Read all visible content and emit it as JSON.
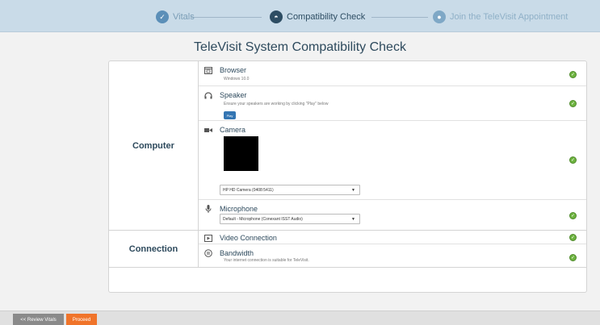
{
  "stepper": {
    "steps": [
      {
        "label": "Vitals",
        "icon": "check-circle-icon",
        "state": "done",
        "glyph": "✓"
      },
      {
        "label": "Compatibility Check",
        "icon": "compatibility-icon",
        "state": "current",
        "glyph": "◓"
      },
      {
        "label": "Join the TeleVisit Appointment",
        "icon": "chat-bubble-icon",
        "state": "pending",
        "glyph": "●"
      }
    ]
  },
  "title": "TeleVisit System Compatibility Check",
  "groups": {
    "computer": "Computer",
    "connection": "Connection"
  },
  "checks": {
    "browser": {
      "name": "Browser",
      "detail": "Windows 10.0",
      "icon": "browser-window-icon",
      "status": "ok"
    },
    "speaker": {
      "name": "Speaker",
      "detail": "Ensure your speakers are working by clicking \"Play\" below",
      "icon": "headphones-icon",
      "button": "Play",
      "status": "ok"
    },
    "camera": {
      "name": "Camera",
      "icon": "video-camera-icon",
      "selected_device": "HP HD Camera (0408:5411)",
      "status": "ok"
    },
    "microphone": {
      "name": "Microphone",
      "icon": "microphone-icon",
      "selected_device": "Default - Microphone (Conexant ISST Audio)",
      "status": "ok"
    },
    "video_connection": {
      "name": "Video Connection",
      "icon": "video-connection-icon",
      "status": "ok"
    },
    "bandwidth": {
      "name": "Bandwidth",
      "detail": "Your internet connection is suitable for TeleVisit.",
      "icon": "bandwidth-icon",
      "status": "ok"
    }
  },
  "footer": {
    "review_label": "<< Review Vitals",
    "proceed_label": "Proceed"
  },
  "colors": {
    "stepper_bg": "#c9dbe8",
    "title": "#2e4a5d",
    "ok_green": "#6db33f",
    "play_blue": "#3476b3",
    "proceed_orange": "#f0742a",
    "review_gray": "#8a8a8a"
  }
}
